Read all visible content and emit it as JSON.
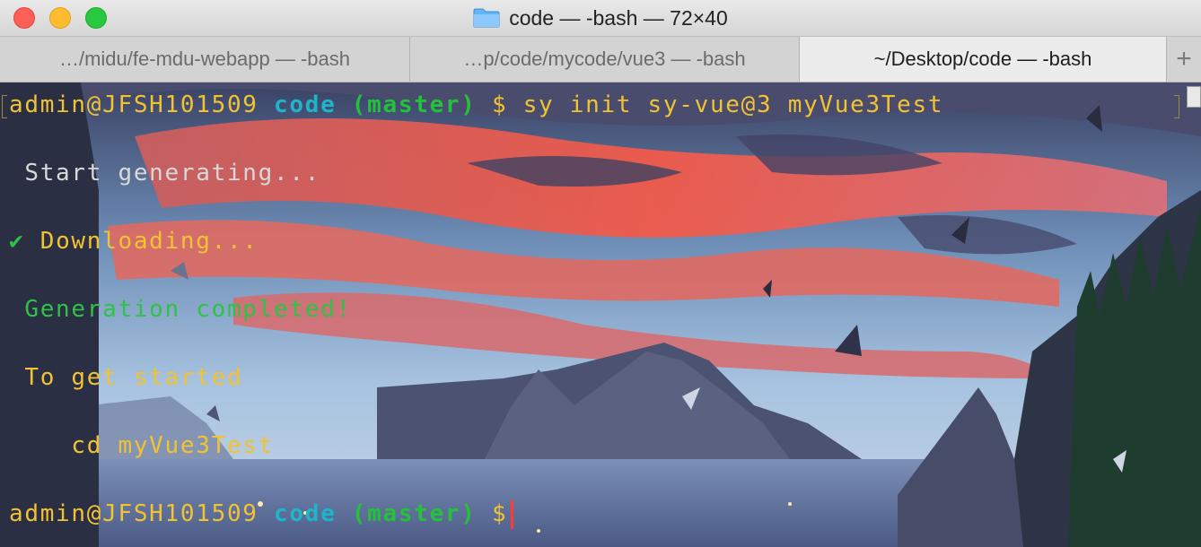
{
  "window": {
    "title": "code — -bash — 72×40",
    "title_icon": "folder-icon"
  },
  "tabs": [
    {
      "label": "…/midu/fe-mdu-webapp — -bash",
      "active": false
    },
    {
      "label": "…p/code/mycode/vue3 — -bash",
      "active": false
    },
    {
      "label": "~/Desktop/code — -bash",
      "active": true
    }
  ],
  "tab_add_label": "+",
  "terminal": {
    "prompt_user": "admin@JFSH101509",
    "prompt_dir": "code",
    "prompt_branch": "(master)",
    "prompt_symbol": "$",
    "command": "sy init sy-vue@3 myVue3Test",
    "start_msg": " Start generating...",
    "check_mark": "✔",
    "download_msg": " Downloading...",
    "complete_msg": " Generation completed!",
    "get_started_msg": " To get started",
    "cd_msg": "    cd myVue3Test"
  },
  "colors": {
    "prompt_user": "#f1c232",
    "prompt_dir": "#1fb5c9",
    "prompt_branch": "#24c13a",
    "cursor": "#ff3b2f"
  }
}
